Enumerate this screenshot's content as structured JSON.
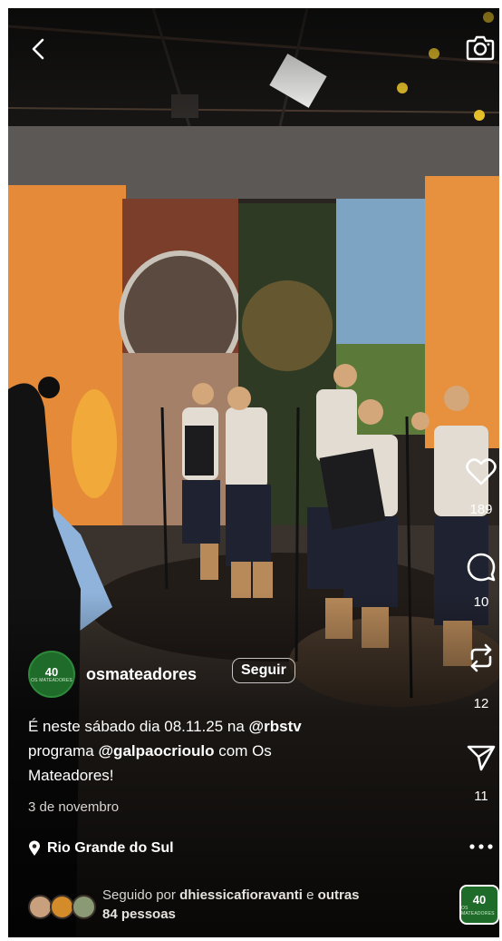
{
  "post": {
    "username": "osmateadores",
    "follow_label": "Seguir",
    "caption_parts": {
      "p1": "É neste sábado dia 08.11.25 na ",
      "mention1": "@rbstv",
      "p2": "programa ",
      "mention2": "@galpaocrioulo",
      "p3": " com Os",
      "p4": "Mateadores!"
    },
    "date": "3 de novembro",
    "location": "Rio Grande do Sul",
    "followed_by": {
      "prefix": "Seguido por ",
      "name": "dhiessicafioravanti",
      "mid": " e ",
      "others": "outras",
      "line2": "84 pessoas"
    },
    "logo_text": "40",
    "logo_subtext": "OS MATEADORES"
  },
  "actions": {
    "likes": "189",
    "comments": "10",
    "reposts": "12",
    "shares": "11"
  },
  "icons": {
    "back": "back-arrow-icon",
    "camera": "camera-icon",
    "like": "heart-icon",
    "comment": "comment-icon",
    "repost": "repost-icon",
    "share": "send-icon",
    "more": "more-icon",
    "location": "location-pin-icon"
  }
}
